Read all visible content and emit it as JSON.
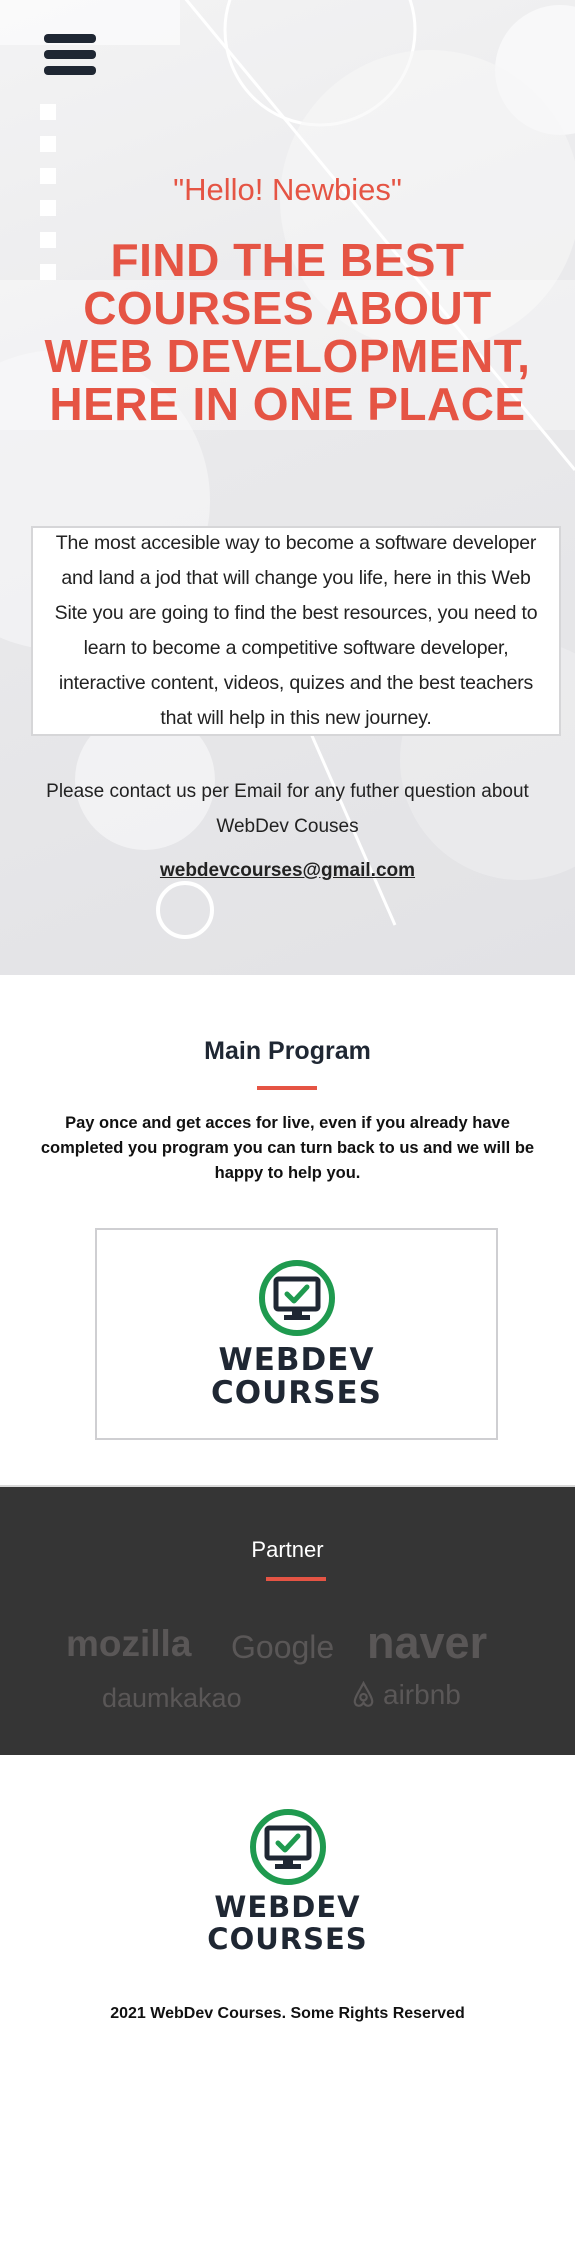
{
  "hero": {
    "menu_icon": "hamburger-menu-icon",
    "greeting": "\"Hello! Newbies\"",
    "headline_lines": [
      "FIND THE BEST",
      "COURSES ABOUT",
      "WEB DEVELOPMENT,",
      "HERE IN ONE PLACE"
    ],
    "about": "The most accesible way to become a software developer and land a jod that will change you life, here in this Web Site you are going to find the best resources, you need to learn to become a competitive software developer, interactive content, videos, quizes and the best teachers that will help in this new journey.",
    "contact_text": "Please contact us per Email for any futher question about WebDev Couses",
    "email": "webdevcourses@gmail.com"
  },
  "program": {
    "title": "Main Program",
    "description": "Pay once and get acces for live, even if you already have completed you program you can turn back to us and we will be happy to help you.",
    "logo": {
      "icon": "monitor-check-icon",
      "line1": "WEBDEV",
      "line2": "COURSES"
    }
  },
  "partner": {
    "title": "Partner",
    "logos": [
      "mozilla",
      "Google",
      "naver",
      "daumkakao",
      "airbnb"
    ],
    "airbnb_icon": "airbnb-icon"
  },
  "footer": {
    "logo": {
      "icon": "monitor-check-icon",
      "line1": "WEBDEV",
      "line2": "COURSES"
    },
    "copyright": "2021 WebDev Courses. Some Rights Reserved"
  },
  "colors": {
    "accent": "#e55444",
    "dark": "#1f2733",
    "logo_green": "#1f9a4f",
    "partner_bg": "#353535",
    "partner_logo": "#5a5757"
  }
}
